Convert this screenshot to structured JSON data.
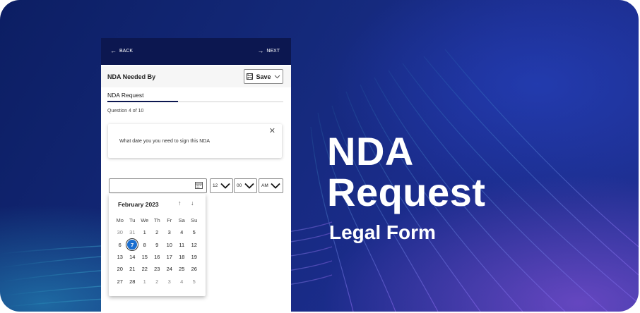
{
  "banner": {
    "title_line1": "NDA",
    "title_line2": "Request",
    "subtitle": "Legal Form"
  },
  "topbar": {
    "back_label": "BACK",
    "next_label": "NEXT"
  },
  "header": {
    "title": "NDA Needed By",
    "save_label": "Save"
  },
  "tab": {
    "label": "NDA Request"
  },
  "progress": {
    "question_text": "Question 4 of 10",
    "fraction": 0.4
  },
  "question_card": {
    "text": "What date you you need to sign this NDA"
  },
  "time_picker": {
    "hour": "12",
    "minute": "00",
    "period": "AM"
  },
  "calendar": {
    "month_label": "February 2023",
    "weekdays": [
      "Mo",
      "Tu",
      "We",
      "Th",
      "Fr",
      "Sa",
      "Su"
    ],
    "weeks": [
      [
        "30",
        "31",
        "1",
        "2",
        "3",
        "4",
        "5"
      ],
      [
        "6",
        "7",
        "8",
        "9",
        "10",
        "11",
        "12"
      ],
      [
        "13",
        "14",
        "15",
        "16",
        "17",
        "18",
        "19"
      ],
      [
        "20",
        "21",
        "22",
        "23",
        "24",
        "25",
        "26"
      ],
      [
        "27",
        "28",
        "1",
        "2",
        "3",
        "4",
        "5"
      ]
    ],
    "selected_day": "7"
  },
  "colors": {
    "navbar": "#0c1750",
    "accent": "#1a6ecf"
  }
}
